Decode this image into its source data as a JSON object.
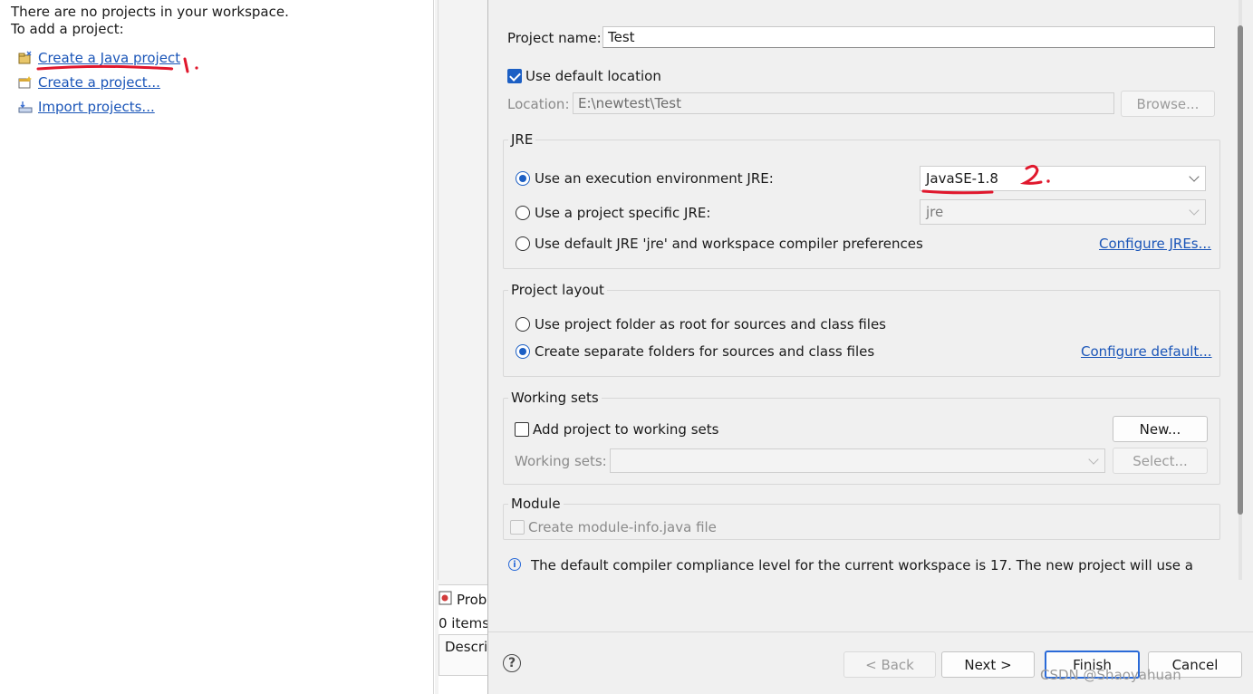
{
  "explorer": {
    "line1": "There are no projects in your workspace.",
    "line2": "To add a project:",
    "links": [
      {
        "label": "Create a Java project",
        "icon": "java-project-icon"
      },
      {
        "label": "Create a project...",
        "icon": "new-project-icon"
      },
      {
        "label": "Import projects...",
        "icon": "import-icon"
      }
    ]
  },
  "problems": {
    "tab_label": "Prob",
    "count": "0 items",
    "column_header": "Descri"
  },
  "dialog": {
    "project_name_label": "Project name:",
    "project_name_value": "Test",
    "use_default_location_label": "Use default location",
    "use_default_location_checked": true,
    "location_label": "Location:",
    "location_value": "E:\\newtest\\Test",
    "browse_label": "Browse...",
    "jre": {
      "title": "JRE",
      "option1_label": "Use an execution environment JRE:",
      "option1_value": "JavaSE-1.8",
      "option2_label": "Use a project specific JRE:",
      "option2_value": "jre",
      "option3_label": "Use default JRE 'jre' and workspace compiler preferences",
      "configure_link": "Configure JREs...",
      "selected": 1
    },
    "layout": {
      "title": "Project layout",
      "option1_label": "Use project folder as root for sources and class files",
      "option2_label": "Create separate folders for sources and class files",
      "configure_link": "Configure default...",
      "selected": 2
    },
    "working_sets": {
      "title": "Working sets",
      "add_label": "Add project to working sets",
      "new_label": "New...",
      "sets_label": "Working sets:",
      "select_label": "Select..."
    },
    "module": {
      "title": "Module",
      "create_label": "Create module-info.java file"
    },
    "info_text": "The default compiler compliance level for the current workspace is 17. The new project will use a",
    "buttons": {
      "back": "< Back",
      "next": "Next >",
      "finish": "Finish",
      "cancel": "Cancel"
    }
  },
  "annotations": {
    "mark1": "1.",
    "mark2": "2."
  },
  "watermark": "CSDN @Shaoyahuan"
}
